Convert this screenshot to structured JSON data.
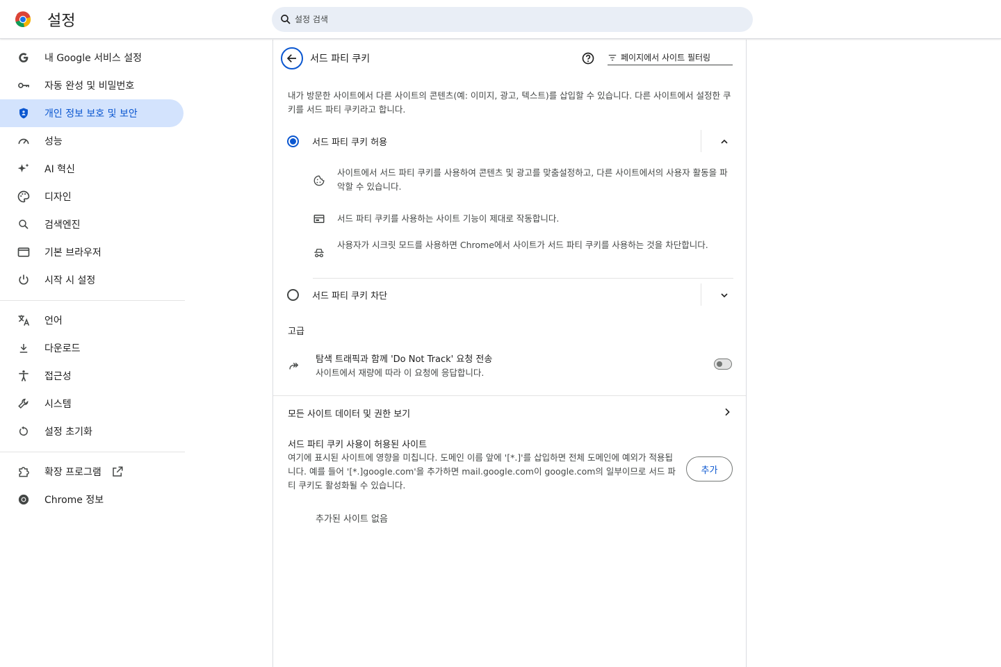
{
  "header": {
    "title": "설정",
    "search_placeholder": "설정 검색"
  },
  "sidebar": {
    "items": [
      {
        "label": "내 Google 서비스 설정",
        "icon": "google-g-icon"
      },
      {
        "label": "자동 완성 및 비밀번호",
        "icon": "key-icon"
      },
      {
        "label": "개인 정보 보호 및 보안",
        "icon": "shield-icon",
        "active": true
      },
      {
        "label": "성능",
        "icon": "speedometer-icon"
      },
      {
        "label": "AI 혁신",
        "icon": "sparkle-icon"
      },
      {
        "label": "디자인",
        "icon": "palette-icon"
      },
      {
        "label": "검색엔진",
        "icon": "search-icon"
      },
      {
        "label": "기본 브라우저",
        "icon": "browser-window-icon"
      },
      {
        "label": "시작 시 설정",
        "icon": "power-icon"
      }
    ],
    "items2": [
      {
        "label": "언어",
        "icon": "translate-icon"
      },
      {
        "label": "다운로드",
        "icon": "download-icon"
      },
      {
        "label": "접근성",
        "icon": "accessibility-icon"
      },
      {
        "label": "시스템",
        "icon": "wrench-icon"
      },
      {
        "label": "설정 초기화",
        "icon": "reset-icon"
      }
    ],
    "items3": [
      {
        "label": "확장 프로그램",
        "icon": "puzzle-icon"
      },
      {
        "label": "Chrome 정보",
        "icon": "chrome-icon"
      }
    ]
  },
  "page": {
    "title": "서드 파티 쿠키",
    "filter_placeholder": "페이지에서 사이트 필터링",
    "description": "내가 방문한 사이트에서 다른 사이트의 콘텐츠(예: 이미지, 광고, 텍스트)를 삽입할 수 있습니다. 다른 사이트에서 설정한 쿠키를 서드 파티 쿠키라고 합니다.",
    "option_allow": "서드 파티 쿠키 허용",
    "option_allow_selected": true,
    "allow_details": [
      "사이트에서 서드 파티 쿠키를 사용하여 콘텐츠 및 광고를 맞춤설정하고, 다른 사이트에서의 사용자 활동을 파악할 수 있습니다.",
      "서드 파티 쿠키를 사용하는 사이트 기능이 제대로 작동합니다.",
      "사용자가 시크릿 모드를 사용하면 Chrome에서 사이트가 서드 파티 쿠키를 사용하는 것을 차단합니다."
    ],
    "option_block": "서드 파티 쿠키 차단",
    "advanced_label": "고급",
    "dnt_title": "탐색 트래픽과 함께 'Do Not Track' 요청 전송",
    "dnt_subtitle": "사이트에서 재량에 따라 이 요청에 응답합니다.",
    "dnt_enabled": false,
    "all_sites_label": "모든 사이트 데이터 및 권한 보기",
    "allowed_title": "서드 파티 쿠키 사용이 허용된 사이트",
    "allowed_desc": "여기에 표시된 사이트에 영향을 미칩니다. 도메인 이름 앞에 '[*.]'를 삽입하면 전체 도메인에 예외가 적용됩니다. 예를 들어 '[*.]google.com'을 추가하면 mail.google.com이 google.com의 일부이므로 서드 파티 쿠키도 활성화될 수 있습니다.",
    "add_button": "추가",
    "no_sites": "추가된 사이트 없음"
  },
  "colors": {
    "accent": "#0b57d0",
    "active_bg": "#d3e3fd",
    "search_bg": "#e9eef6"
  }
}
